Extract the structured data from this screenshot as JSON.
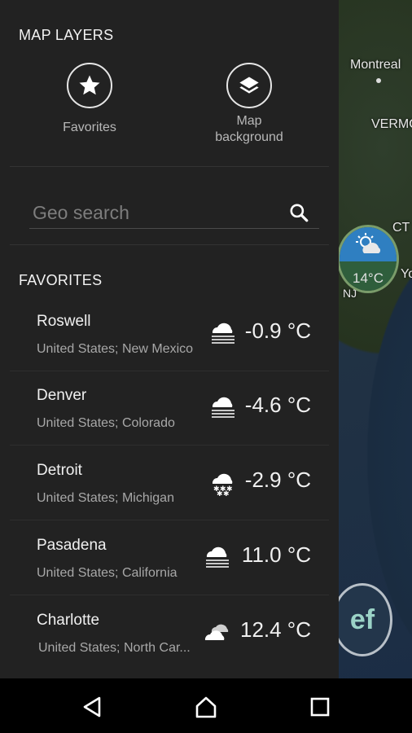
{
  "map": {
    "labels": [
      "Montreal",
      "VERMO",
      "CT",
      "NJ",
      "Yo"
    ],
    "marker_temp": "14°C"
  },
  "drawer": {
    "map_layers_title": "MAP LAYERS",
    "layers": [
      {
        "label": "Favorites",
        "icon": "star-icon"
      },
      {
        "label_line1": "Map",
        "label_line2": "background",
        "icon": "layers-icon"
      }
    ],
    "search": {
      "placeholder": "Geo search"
    },
    "favorites_title": "FAVORITES",
    "favorites": [
      {
        "city": "Roswell",
        "location": "United States; New Mexico",
        "temp": "-0.9 °C",
        "icon": "fog-cloud-icon"
      },
      {
        "city": "Denver",
        "location": "United States; Colorado",
        "temp": "-4.6 °C",
        "icon": "fog-cloud-icon"
      },
      {
        "city": "Detroit",
        "location": "United States; Michigan",
        "temp": "-2.9 °C",
        "icon": "snow-cloud-icon"
      },
      {
        "city": "Pasadena",
        "location": "United States; California",
        "temp": "11.0 °C",
        "icon": "fog-cloud-icon"
      },
      {
        "city": "Charlotte",
        "location": "United States; North Car...",
        "temp": "12.4 °C",
        "icon": "cloudy-icon"
      }
    ]
  },
  "navbar": {
    "buttons": [
      "back-button",
      "home-button",
      "recents-button"
    ]
  }
}
